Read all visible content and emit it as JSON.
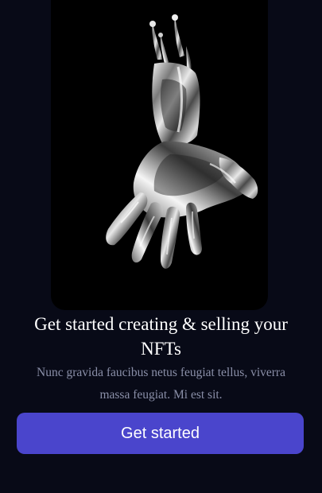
{
  "hero": {
    "image_icon": "chrome-hand-icon"
  },
  "content": {
    "headline": "Get started creating & selling your NFTs",
    "subtext": "Nunc gravida faucibus netus feugiat tellus, viverra massa feugiat. Mi est sit."
  },
  "cta": {
    "label": "Get started"
  },
  "colors": {
    "background": "#080a17",
    "card": "#000000",
    "accent": "#4a45cc",
    "text": "#ffffff",
    "muted": "#8a8fa8"
  }
}
